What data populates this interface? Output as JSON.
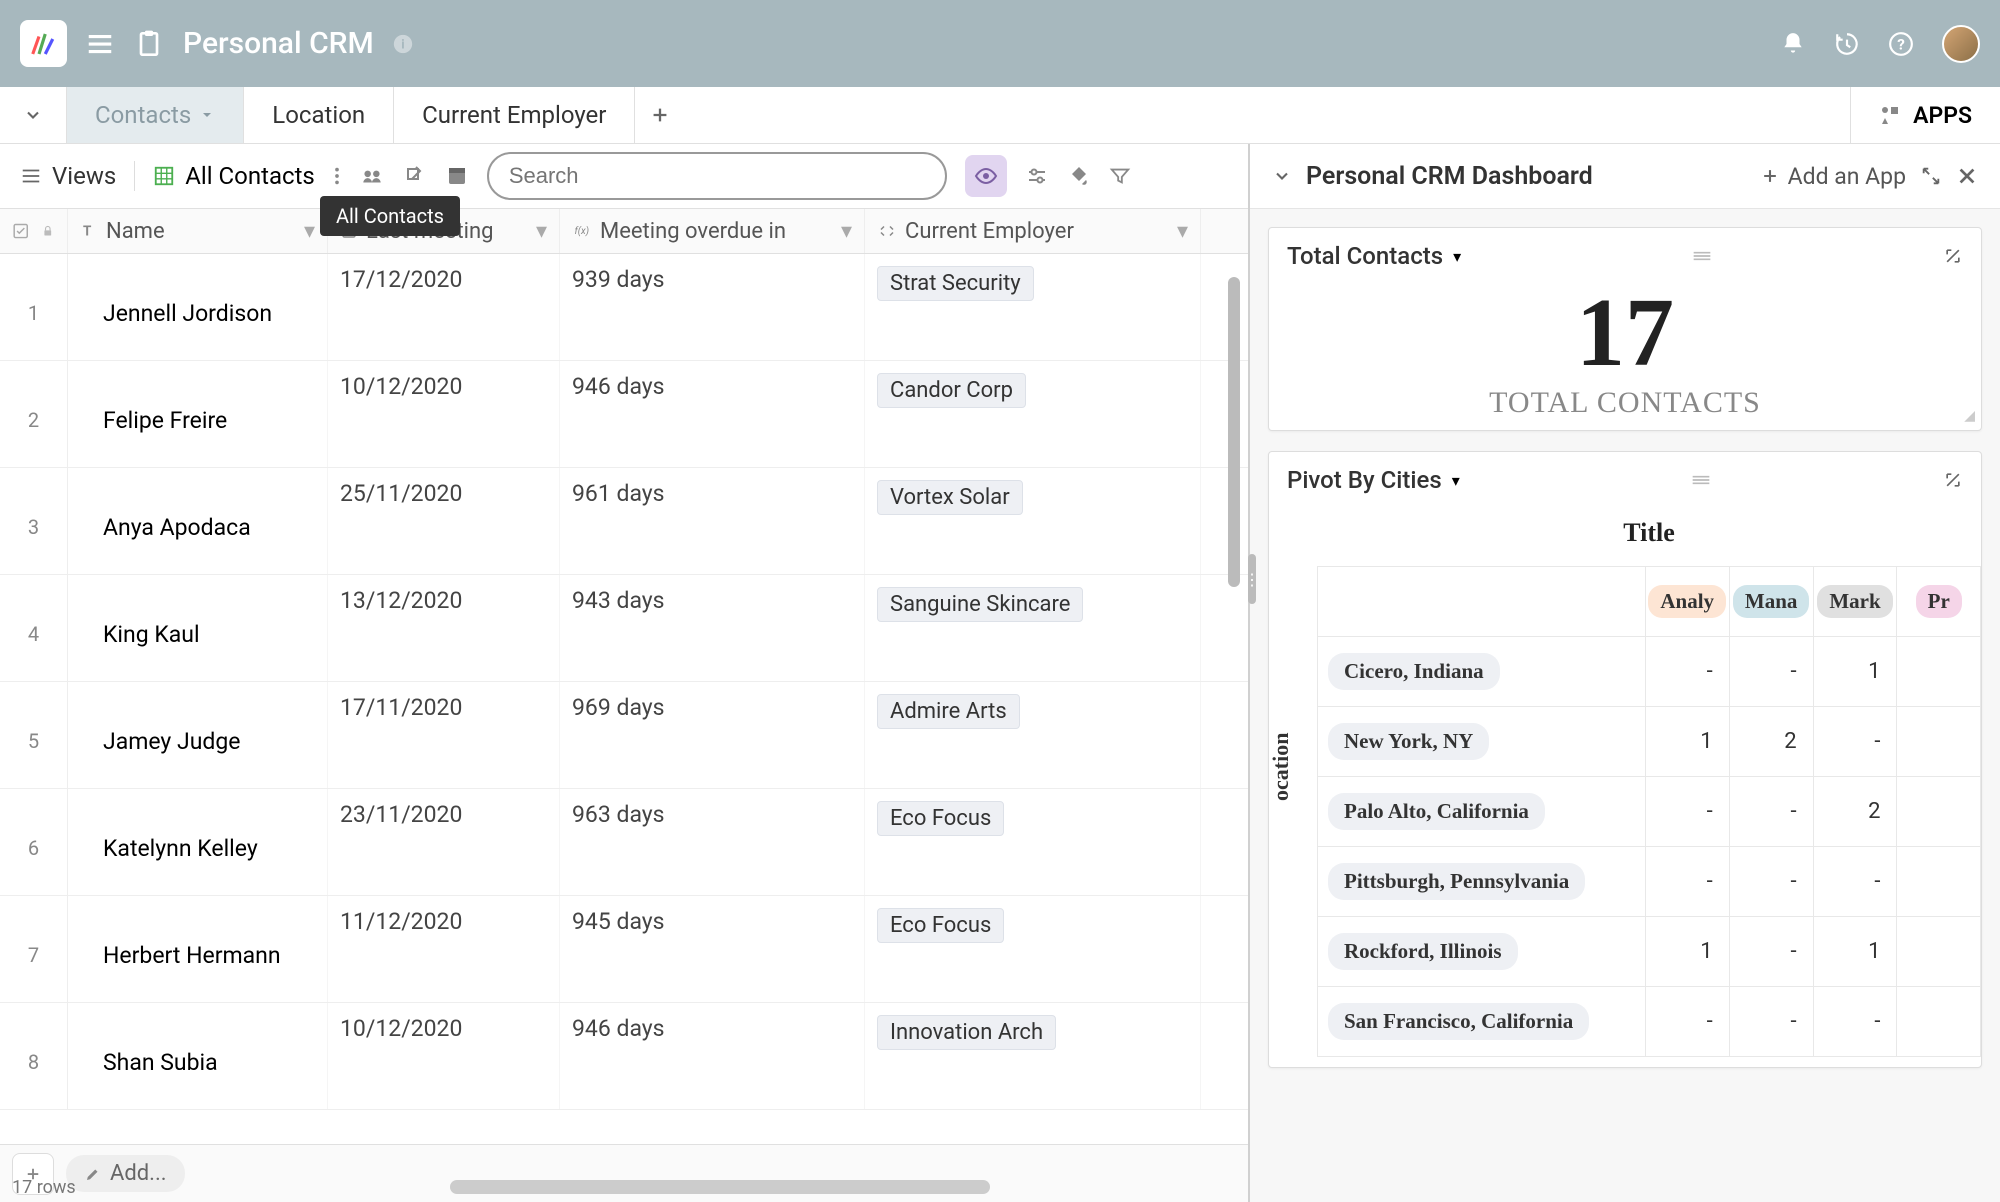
{
  "app": {
    "title": "Personal CRM"
  },
  "tabs": [
    {
      "label": "Contacts",
      "active": true
    },
    {
      "label": "Location",
      "active": false
    },
    {
      "label": "Current Employer",
      "active": false
    }
  ],
  "apps_button": "APPS",
  "toolbar": {
    "views": "Views",
    "current_view": "All Contacts",
    "search_placeholder": "Search",
    "tooltip": "All Contacts"
  },
  "columns": {
    "name": "Name",
    "last_meeting": "Last meeting",
    "meeting_overdue": "Meeting overdue in",
    "current_employer": "Current Employer"
  },
  "rows": [
    {
      "n": "1",
      "name": "Jennell Jordison",
      "lm": "17/12/2020",
      "mo": "939 days",
      "ce": "Strat Security"
    },
    {
      "n": "2",
      "name": "Felipe Freire",
      "lm": "10/12/2020",
      "mo": "946 days",
      "ce": "Candor Corp"
    },
    {
      "n": "3",
      "name": "Anya Apodaca",
      "lm": "25/11/2020",
      "mo": "961 days",
      "ce": "Vortex Solar"
    },
    {
      "n": "4",
      "name": "King Kaul",
      "lm": "13/12/2020",
      "mo": "943 days",
      "ce": "Sanguine Skincare"
    },
    {
      "n": "5",
      "name": "Jamey Judge",
      "lm": "17/11/2020",
      "mo": "969 days",
      "ce": "Admire Arts"
    },
    {
      "n": "6",
      "name": "Katelynn Kelley",
      "lm": "23/11/2020",
      "mo": "963 days",
      "ce": "Eco Focus"
    },
    {
      "n": "7",
      "name": "Herbert Hermann",
      "lm": "11/12/2020",
      "mo": "945 days",
      "ce": "Eco Focus"
    },
    {
      "n": "8",
      "name": "Shan Subia",
      "lm": "10/12/2020",
      "mo": "946 days",
      "ce": "Innovation Arch"
    }
  ],
  "footer": {
    "add": "Add...",
    "row_count": "17 rows"
  },
  "dashboard": {
    "title": "Personal CRM Dashboard",
    "add_app": "Add an App",
    "total_widget": {
      "title": "Total Contacts",
      "value": "17",
      "label": "TOTAL CONTACTS"
    },
    "pivot_widget": {
      "title": "Pivot By Cities",
      "table_title": "Title",
      "y_axis": "ocation",
      "col_headers": [
        "Analy",
        "Mana",
        "Mark",
        "Pr"
      ],
      "rows": [
        {
          "city": "Cicero, Indiana",
          "vals": [
            "-",
            "-",
            "1",
            ""
          ]
        },
        {
          "city": "New York, NY",
          "vals": [
            "1",
            "2",
            "-",
            ""
          ]
        },
        {
          "city": "Palo Alto, California",
          "vals": [
            "-",
            "-",
            "2",
            ""
          ]
        },
        {
          "city": "Pittsburgh, Pennsylvania",
          "vals": [
            "-",
            "-",
            "-",
            ""
          ]
        },
        {
          "city": "Rockford, Illinois",
          "vals": [
            "1",
            "-",
            "1",
            ""
          ]
        },
        {
          "city": "San Francisco, California",
          "vals": [
            "-",
            "-",
            "-",
            ""
          ]
        }
      ]
    }
  }
}
